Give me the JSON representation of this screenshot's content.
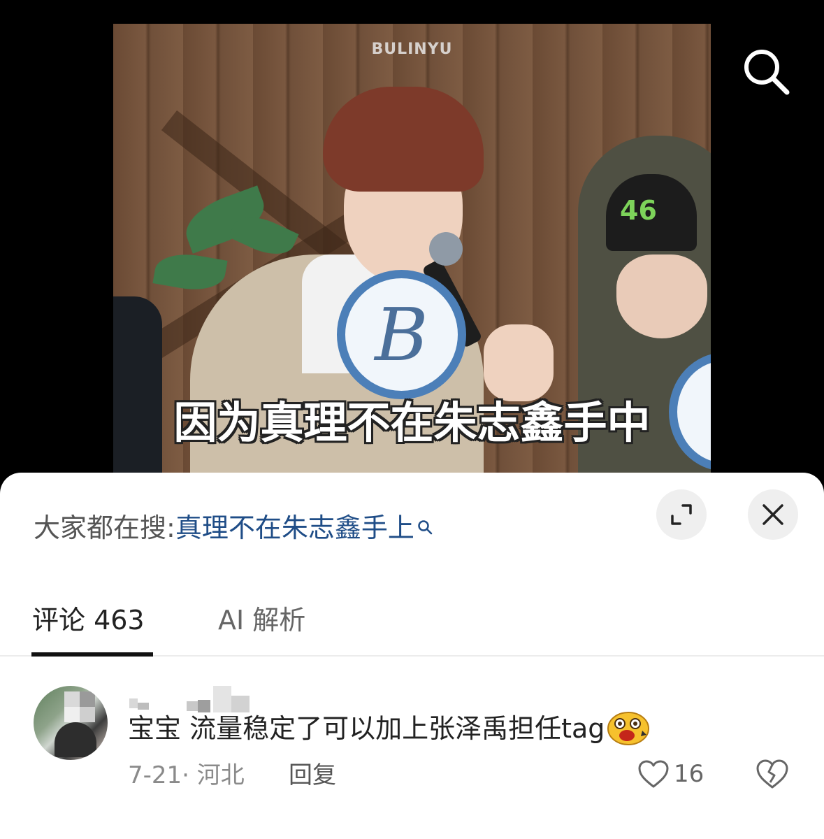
{
  "video": {
    "watermark": "BULINYU",
    "subtitle": "因为真理不在朱志鑫手中",
    "sign_letter": "B",
    "cap_number": "46"
  },
  "top_bar": {
    "search_icon": "search-icon"
  },
  "hot_search": {
    "prefix": "大家都在搜:",
    "query": "真理不在朱志鑫手上",
    "icon": "search-icon"
  },
  "sheet_controls": {
    "expand_icon": "expand-icon",
    "close_icon": "close-icon"
  },
  "tabs": [
    {
      "label": "评论 463",
      "active": true
    },
    {
      "label": "AI 解析",
      "active": false
    }
  ],
  "comment": {
    "text": "宝宝 流量稳定了可以加上张泽禹担任tag",
    "emoji": "shocked-emoji",
    "meta": "7-21· 河北",
    "reply_label": "回复",
    "like_count": "16",
    "like_icon": "heart-icon",
    "dislike_icon": "broken-heart-icon"
  },
  "colors": {
    "link": "#1f4d87",
    "sheet_bg": "#ffffff",
    "video_bg": "#000000"
  }
}
